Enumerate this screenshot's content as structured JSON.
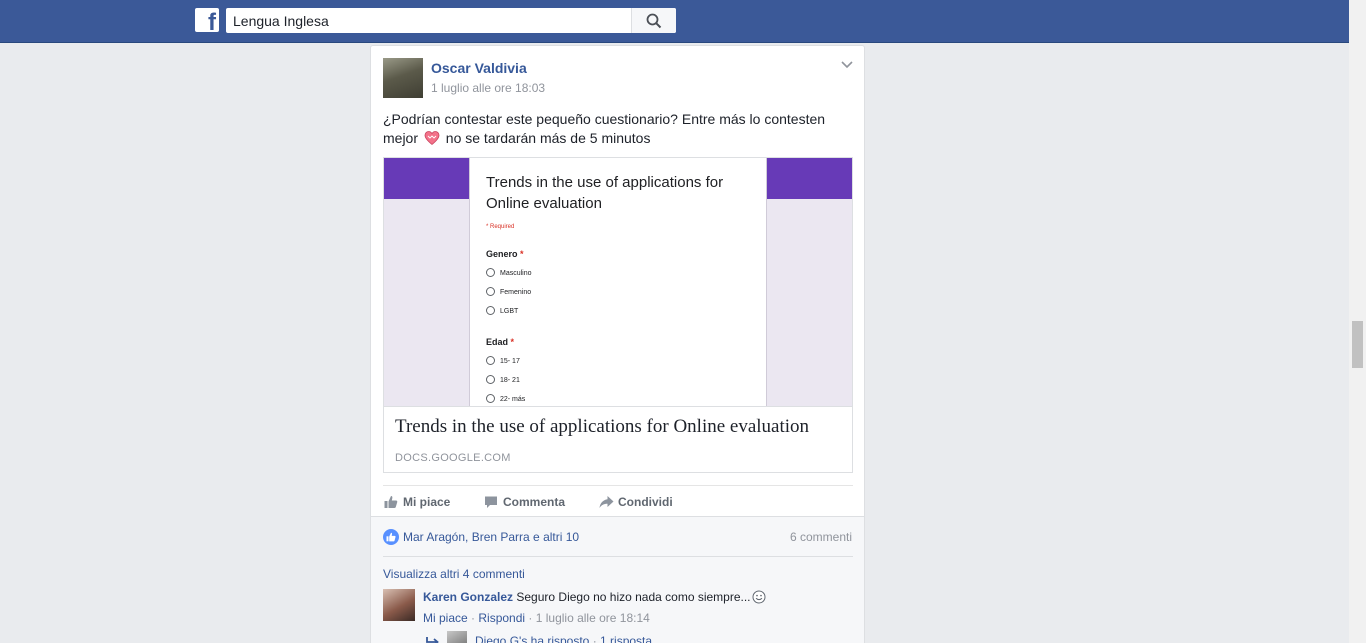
{
  "topbar": {
    "logo_letter": "f",
    "search_value": "Lengua Inglesa"
  },
  "post": {
    "author": "Oscar Valdivia",
    "timestamp": "1 luglio alle ore 18:03",
    "text_part1": "¿Podrían contestar este pequeño cuestionario? Entre más lo contesten mejor",
    "emoji": "heart-emoji",
    "text_part2": "no se tardarán más de 5 minutos",
    "attachment": {
      "form": {
        "title": "Trends in the use of applications for Online evaluation",
        "required_note": "* Required",
        "questions": [
          {
            "label": "Genero",
            "star": "*",
            "options": [
              "Masculino",
              "Femenino",
              "LGBT"
            ]
          },
          {
            "label": "Edad",
            "star": "*",
            "options": [
              "15- 17",
              "18- 21",
              "22- más"
            ]
          }
        ]
      },
      "title": "Trends in the use of applications for Online evaluation",
      "domain": "DOCS.GOOGLE.COM"
    },
    "actions": {
      "like": "Mi piace",
      "comment": "Commenta",
      "share": "Condividi"
    },
    "reactions": {
      "likers": "Mar Aragón, Bren Parra e altri 10",
      "comment_count": "6 commenti"
    },
    "comments": {
      "view_more": "Visualizza altri 4 commenti",
      "first": {
        "author": "Karen Gonzalez",
        "text": "Seguro Diego no hizo nada como siempre...",
        "like": "Mi piace",
        "reply": "Rispondi",
        "time": "1 luglio alle ore 18:14",
        "separator": " · "
      },
      "reply_summary": {
        "text": "Diego G's ha risposto",
        "separator": " · ",
        "count": "1 risposta"
      }
    }
  },
  "colors": {
    "brand": "#3b5998",
    "link": "#365899",
    "form_accent": "#673ab7",
    "like_badge": "#5890ff"
  }
}
